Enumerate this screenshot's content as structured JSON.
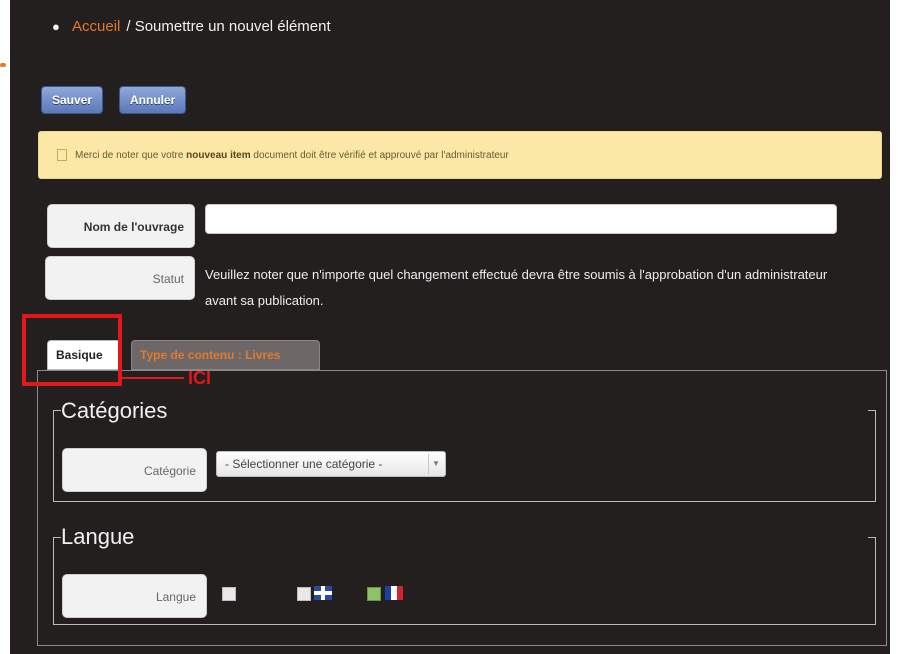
{
  "breadcrumb": {
    "home": "Accueil",
    "separator": "/",
    "current": "Soumettre un nouvel élément"
  },
  "toolbar": {
    "save_label": "Sauver",
    "cancel_label": "Annuler"
  },
  "notice": {
    "prefix": "Merci de noter que votre",
    "highlight": "nouveau item",
    "suffix": "document doit être vérifié et approuvé par l'administrateur"
  },
  "form": {
    "name_label": "Nom de l'ouvrage",
    "name_value": "",
    "status_label": "Statut",
    "status_text": "Veuillez noter que n'importe quel changement effectué devra être soumis à l'approbation d'un administrateur avant sa publication."
  },
  "tabs": [
    {
      "label": "Basique",
      "active": true
    },
    {
      "label": "Type de contenu : Livres",
      "active": false
    }
  ],
  "annotation": {
    "text": "ICI",
    "color": "#e1181b"
  },
  "categories": {
    "legend": "Catégories",
    "field_label": "Catégorie",
    "select_value": "- Sélectionner une catégorie -"
  },
  "language": {
    "legend": "Langue",
    "field_label": "Langue",
    "options": [
      {
        "flag": "none",
        "checked": false
      },
      {
        "flag": "uk-flag-icon",
        "checked": false
      },
      {
        "flag": "fr-flag-icon",
        "checked": true
      }
    ]
  },
  "colors": {
    "background": "#231f1f",
    "accent": "#e07a2c",
    "button": "#6a86c4",
    "notice_bg": "#fbe8a6"
  }
}
